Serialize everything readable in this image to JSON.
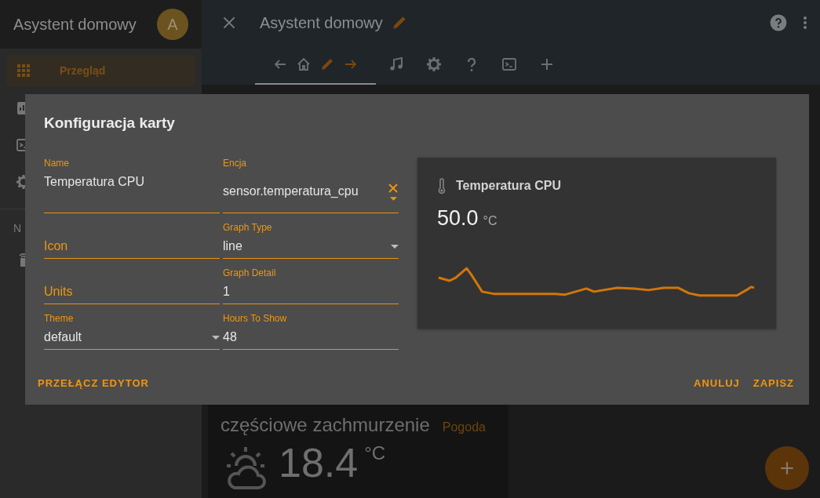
{
  "sidebar": {
    "title": "Asystent domowy",
    "avatar": "A",
    "items": [
      {
        "kind": "grid",
        "label": "Przegląd",
        "selected": true
      },
      {
        "kind": "chart"
      },
      {
        "kind": "terminal"
      },
      {
        "kind": "gear"
      }
    ],
    "section": "N",
    "section_items": [
      {
        "kind": "remote"
      }
    ]
  },
  "header": {
    "title": "Asystent domowy",
    "tabs": [
      {
        "kind": "view-edit",
        "selected": true
      },
      {
        "kind": "music",
        "selected": false
      },
      {
        "kind": "gear",
        "selected": false
      },
      {
        "kind": "help",
        "selected": false
      },
      {
        "kind": "terminal",
        "selected": false
      },
      {
        "kind": "plus",
        "selected": false
      }
    ]
  },
  "weather_card": {
    "condition": "częściowe zachmurzenie",
    "name": "Pogoda",
    "temperature": "18.4",
    "unit": "°C"
  },
  "dialog": {
    "title": "Konfiguracja karty",
    "field_rows": [
      [
        {
          "kind": "text",
          "label": "Name",
          "value": "Temperatura CPU"
        },
        {
          "kind": "entity",
          "label": "Encja",
          "value": "sensor.temperatura_cpu"
        }
      ],
      [
        {
          "kind": "text",
          "label": "Icon"
        },
        {
          "kind": "select",
          "label": "Graph Type",
          "value": "line"
        }
      ],
      [
        {
          "kind": "text",
          "label": "Units"
        },
        {
          "kind": "text",
          "label": "Graph Detail",
          "value": "1"
        }
      ],
      [
        {
          "kind": "select",
          "label": "Theme",
          "value": "default"
        },
        {
          "kind": "text",
          "label": "Hours To Show",
          "value": "48"
        }
      ]
    ],
    "preview": {
      "name": "Temperatura CPU",
      "state": "50.0",
      "unit": "°C"
    },
    "actions": [
      {
        "label": "PRZEŁĄCZ EDYTOR"
      },
      {
        "label": "ANULUJ"
      },
      {
        "label": "ZAPISZ"
      }
    ]
  }
}
